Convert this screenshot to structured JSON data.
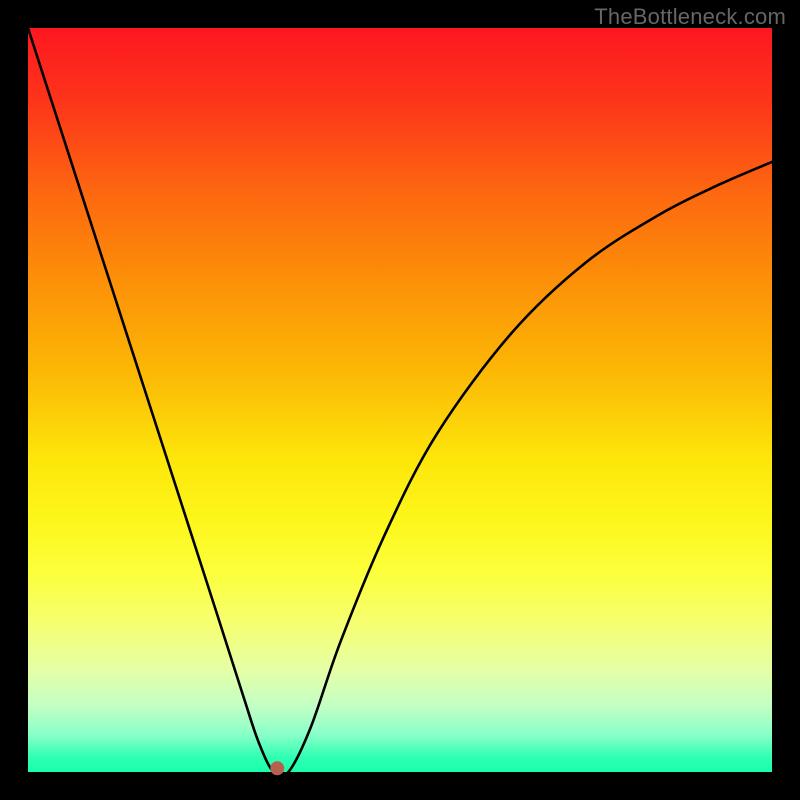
{
  "watermark": "TheBottleneck.com",
  "chart_data": {
    "type": "line",
    "title": "",
    "xlabel": "",
    "ylabel": "",
    "xlim": [
      0,
      1
    ],
    "ylim": [
      0,
      1
    ],
    "series": [
      {
        "name": "curve",
        "x": [
          0.0,
          0.05,
          0.1,
          0.15,
          0.2,
          0.25,
          0.29,
          0.31,
          0.33,
          0.35,
          0.38,
          0.42,
          0.48,
          0.55,
          0.65,
          0.75,
          0.85,
          0.93,
          1.0
        ],
        "y": [
          1.0,
          0.845,
          0.69,
          0.535,
          0.38,
          0.225,
          0.1,
          0.04,
          0.0,
          0.0,
          0.06,
          0.175,
          0.32,
          0.455,
          0.59,
          0.685,
          0.75,
          0.79,
          0.82
        ]
      }
    ],
    "marker": {
      "x": 0.335,
      "y": 0.005,
      "color": "#b7604e",
      "radius": 7
    }
  }
}
